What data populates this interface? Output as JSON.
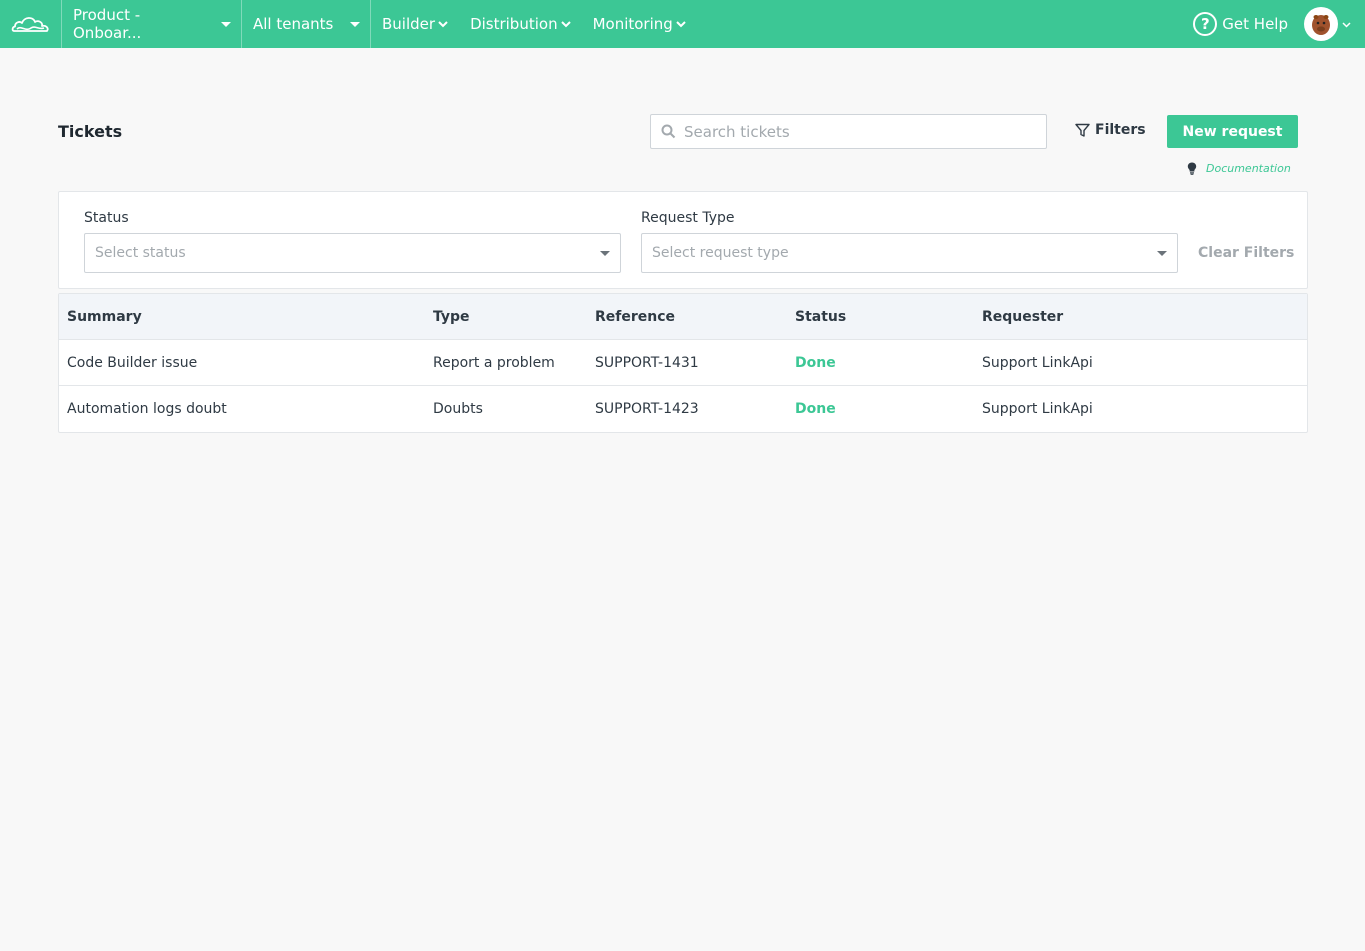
{
  "colors": {
    "brand": "#3cc795",
    "done": "#3cc795"
  },
  "topbar": {
    "product_select": "Product - Onboar...",
    "tenant_select": "All tenants",
    "menus": [
      {
        "label": "Builder",
        "icon": "chevron-down-icon"
      },
      {
        "label": "Distribution",
        "icon": "chevron-down-icon"
      },
      {
        "label": "Monitoring",
        "icon": "chevron-down-icon"
      }
    ],
    "help_label": "Get Help"
  },
  "page": {
    "title": "Tickets",
    "search_placeholder": "Search tickets",
    "filters_label": "Filters",
    "new_request_label": "New request",
    "documentation_label": "Documentation"
  },
  "filters": {
    "status_label": "Status",
    "status_placeholder": "Select status",
    "type_label": "Request Type",
    "type_placeholder": "Select request type",
    "clear_label": "Clear Filters"
  },
  "table": {
    "headers": [
      "Summary",
      "Type",
      "Reference",
      "Status",
      "Requester"
    ],
    "rows": [
      {
        "summary": "Code Builder issue",
        "type": "Report a problem",
        "reference": "SUPPORT-1431",
        "status": "Done",
        "requester": "Support LinkApi"
      },
      {
        "summary": "Automation logs doubt",
        "type": "Doubts",
        "reference": "SUPPORT-1423",
        "status": "Done",
        "requester": "Support LinkApi"
      }
    ]
  }
}
